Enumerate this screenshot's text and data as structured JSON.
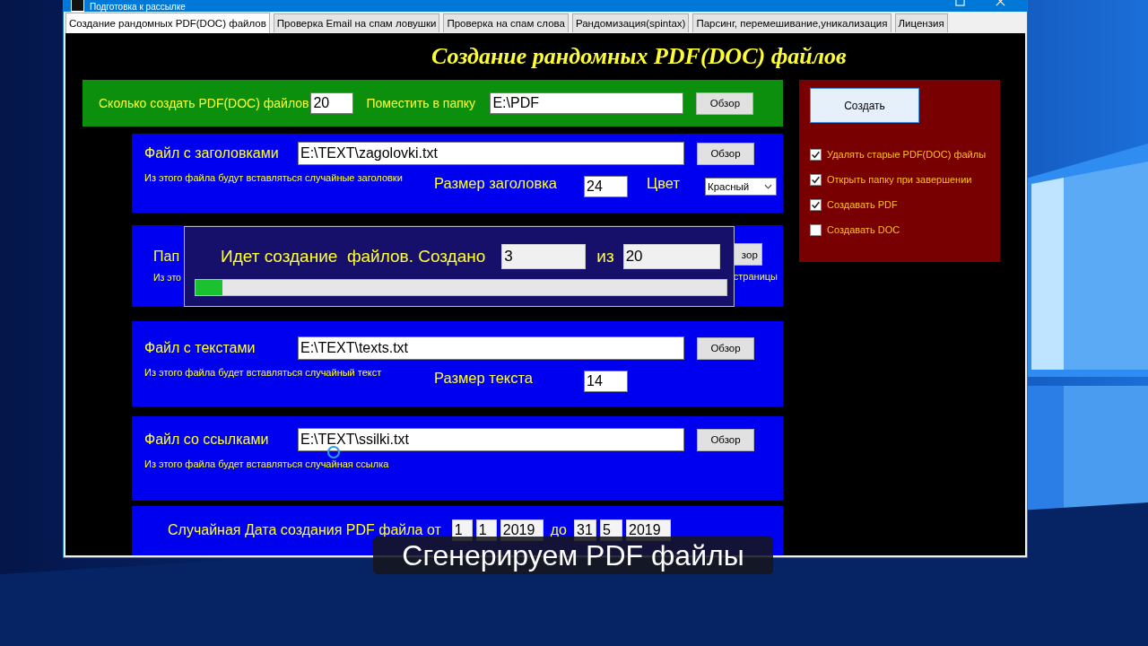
{
  "window": {
    "title": "Подготовка к рассылке"
  },
  "tabs": [
    {
      "label": "Создание рандомных PDF(DOC) файлов",
      "selected": true
    },
    {
      "label": "Проверка Email на спам ловушки",
      "selected": false
    },
    {
      "label": "Проверка на спам слова",
      "selected": false
    },
    {
      "label": "Рандомизация(spintax)",
      "selected": false
    },
    {
      "label": "Парсинг, перемешивание,уникализация",
      "selected": false
    },
    {
      "label": "Лицензия",
      "selected": false
    }
  ],
  "heading": "Создание рандомных PDF(DOC) файлов",
  "general": {
    "count_label": "Сколько создать PDF(DOC) файлов",
    "count_value": "20",
    "folder_label": "Поместить в папку",
    "folder_value": "E:\\PDF",
    "browse": "Обзор"
  },
  "sections": [
    {
      "kind": "file",
      "label": "Файл с заголовками",
      "path": "E:\\TEXT\\zagolovki.txt",
      "browse": "Обзор",
      "note": "Из этого файла будут вставляться случайные заголовки",
      "size_label": "Размер заголовка",
      "size_value": "24",
      "color_label": "Цвет",
      "color_value": "Красный"
    },
    {
      "kind": "covered",
      "label": "Пап",
      "note": "Из это",
      "browse": "зор",
      "note_end": "страницы"
    },
    {
      "kind": "file",
      "label": "Файл с текстами",
      "path": "E:\\TEXT\\texts.txt",
      "browse": "Обзор",
      "note": "Из этого файла будет вставляться случайный текст",
      "size_label": "Размер текста",
      "size_value": "14"
    },
    {
      "kind": "file",
      "label": "Файл со ссылками",
      "path": "E:\\TEXT\\ssilki.txt",
      "browse": "Обзор",
      "note": "Из этого файла будет вставляться случайная ссылка"
    },
    {
      "kind": "dates",
      "label": "Случайная Дата создания PDF файла от",
      "from": [
        "1",
        "1",
        "2019"
      ],
      "to_label": "до",
      "to": [
        "31",
        "5",
        "2019"
      ]
    }
  ],
  "actions": {
    "create": "Создать",
    "options": [
      {
        "label": "Удалять старые PDF(DOC) файлы",
        "checked": true
      },
      {
        "label": "Открыть папку при завершении",
        "checked": true
      },
      {
        "label": "Создавать PDF",
        "checked": true
      },
      {
        "label": "Создавать DOC",
        "checked": false
      }
    ]
  },
  "progress_dialog": {
    "message": "Идет создание  файлов. Создано",
    "created": "3",
    "of_label": "из",
    "total": "20",
    "level": 0.05
  },
  "caption": "Сгенерируем PDF файлы"
}
